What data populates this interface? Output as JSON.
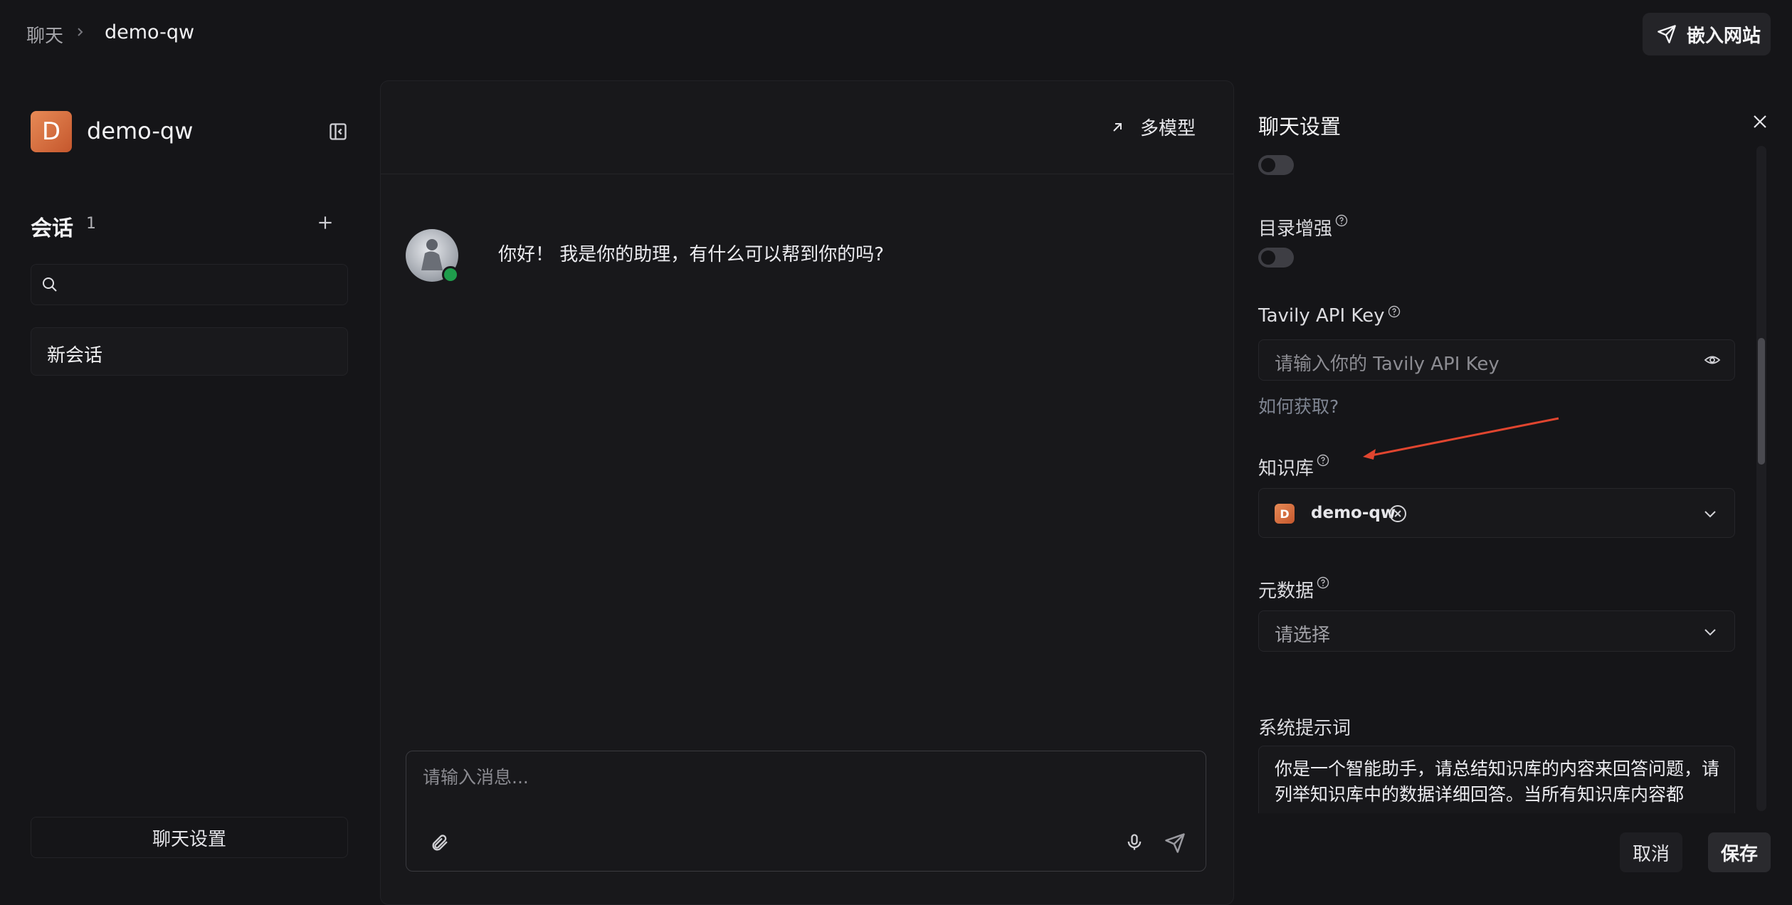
{
  "breadcrumb": {
    "root": "聊天",
    "current": "demo-qw"
  },
  "header": {
    "embed_label": "嵌入网站"
  },
  "sidebar": {
    "logo_letter": "D",
    "app_name": "demo-qw",
    "sessions_title": "会话",
    "sessions_count": "1",
    "search_placeholder": "",
    "items": [
      {
        "label": "新会话"
      }
    ],
    "settings_label": "聊天设置"
  },
  "chat": {
    "multi_model_label": "多模型",
    "greeting": "你好！ 我是你的助理，有什么可以帮到你的吗?",
    "input_placeholder": "请输入消息..."
  },
  "settings": {
    "title": "聊天设置",
    "dir_enhance_label": "目录增强",
    "tavily_label": "Tavily API Key",
    "tavily_placeholder": "请输入你的 Tavily API Key",
    "how_get": "如何获取?",
    "kb_label": "知识库",
    "kb_logo_letter": "D",
    "kb_selected": "demo-qw",
    "meta_label": "元数据",
    "meta_placeholder": "请选择",
    "system_prompt_label": "系统提示词",
    "system_prompt": "你是一个智能助手，请总结知识库的内容来回答问题，请列举知识库中的数据详细回答。当所有知识库内容都",
    "cancel_label": "取消",
    "save_label": "保存"
  },
  "colors": {
    "accent": "#d9683a",
    "online": "#1f9d4c",
    "annotation_arrow": "#e0452f"
  },
  "icons": [
    "send-icon",
    "chevron-right-icon",
    "sidebar-collapse-icon",
    "plus-icon",
    "search-icon",
    "arrow-up-right-icon",
    "paperclip-icon",
    "microphone-icon",
    "close-icon",
    "help-icon",
    "eye-icon",
    "remove-circle-icon",
    "chevron-down-icon"
  ]
}
